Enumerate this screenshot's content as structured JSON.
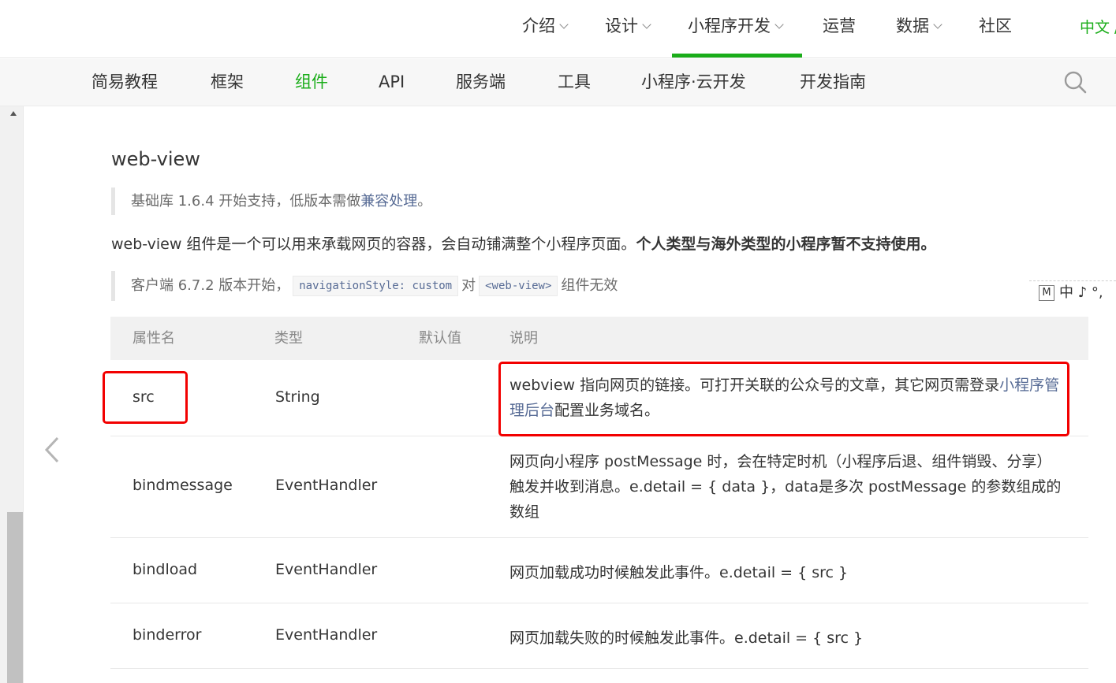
{
  "topnav": {
    "items": [
      {
        "label": "介绍",
        "dropdown": true
      },
      {
        "label": "设计",
        "dropdown": true
      },
      {
        "label": "小程序开发",
        "dropdown": true,
        "active": true
      },
      {
        "label": "运营",
        "dropdown": false
      },
      {
        "label": "数据",
        "dropdown": true
      },
      {
        "label": "社区",
        "dropdown": false
      }
    ],
    "language": "中文 /"
  },
  "subnav": {
    "items": [
      {
        "label": "简易教程"
      },
      {
        "label": "框架"
      },
      {
        "label": "组件",
        "active": true
      },
      {
        "label": "API"
      },
      {
        "label": "服务端"
      },
      {
        "label": "工具"
      },
      {
        "label": "小程序·云开发"
      },
      {
        "label": "开发指南"
      }
    ]
  },
  "content": {
    "title": "web-view",
    "note1": {
      "prefix": "基础库 1.6.4 开始支持，低版本需做",
      "link": "兼容处理",
      "suffix": "。"
    },
    "description": {
      "text": "web-view 组件是一个可以用来承载网页的容器，会自动铺满整个小程序页面。",
      "bold": "个人类型与海外类型的小程序暂不支持使用。"
    },
    "note2": {
      "prefix": "客户端 6.7.2 版本开始，",
      "code1": "navigationStyle: custom",
      "middle": "对",
      "code2": "<web-view>",
      "suffix": "组件无效"
    }
  },
  "ime_toolbar": {
    "badge": "M",
    "text": "中 ♪ °,"
  },
  "table": {
    "headers": [
      "属性名",
      "类型",
      "默认值",
      "说明"
    ],
    "rows": [
      {
        "name": "src",
        "type": "String",
        "default": "",
        "desc_prefix": "webview 指向网页的链接。可打开关联的公众号的文章，其它网页需登录",
        "desc_link": "小程序管理后台",
        "desc_suffix": "配置业务域名。"
      },
      {
        "name": "bindmessage",
        "type": "EventHandler",
        "default": "",
        "desc": "网页向小程序 postMessage 时，会在特定时机（小程序后退、组件销毁、分享）触发并收到消息。e.detail = { data }，data是多次 postMessage 的参数组成的数组"
      },
      {
        "name": "bindload",
        "type": "EventHandler",
        "default": "",
        "desc": "网页加载成功时候触发此事件。e.detail = { src }"
      },
      {
        "name": "binderror",
        "type": "EventHandler",
        "default": "",
        "desc": "网页加载失败的时候触发此事件。e.detail = { src }"
      }
    ]
  },
  "colors": {
    "accent": "#1aad19",
    "link": "#576b95",
    "highlight": "#f20000"
  },
  "icons": {
    "search": "search-icon",
    "prev": "chevron-left-icon",
    "dropdown": "chevron-down-icon"
  }
}
